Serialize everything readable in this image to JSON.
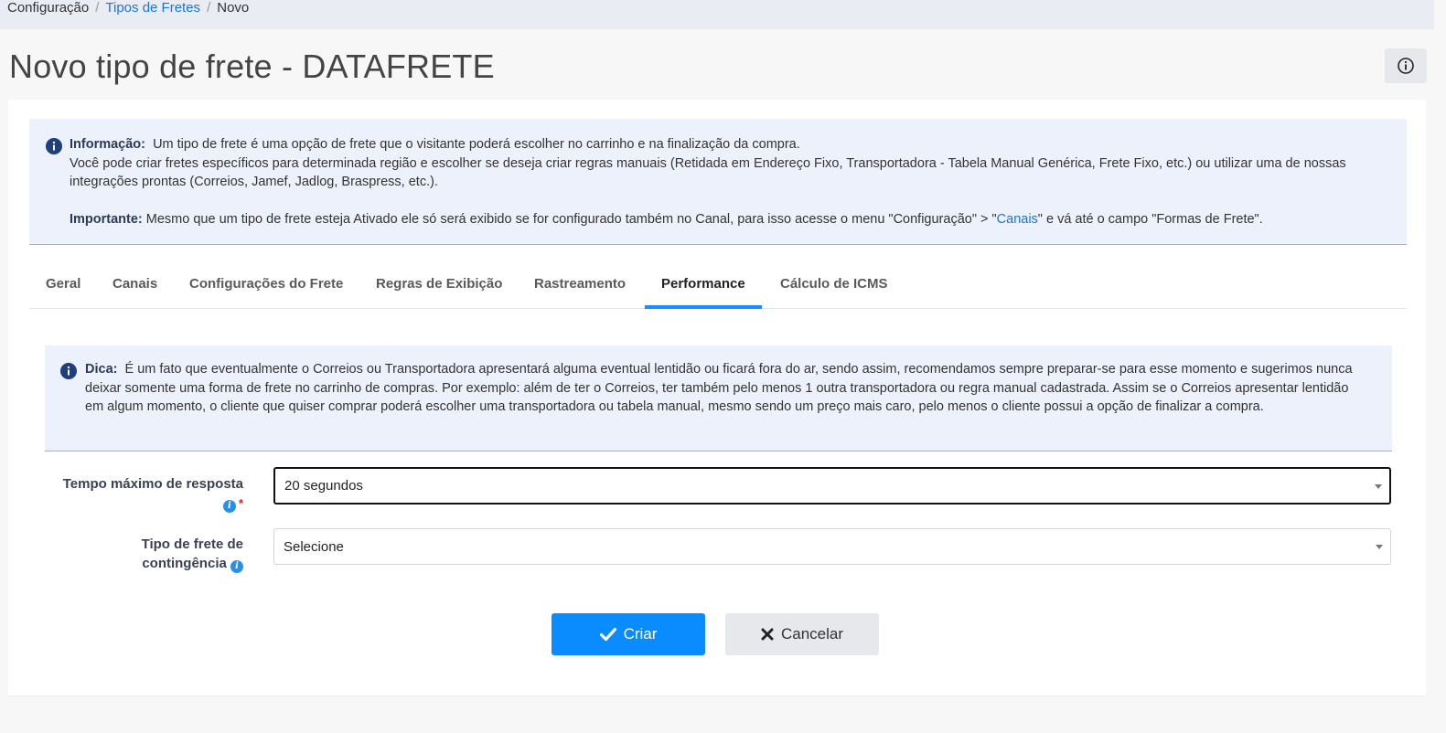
{
  "breadcrumb": {
    "items": [
      "Configuração",
      "Tipos de Fretes",
      "Novo"
    ],
    "separator": "/"
  },
  "page_title": "Novo tipo de frete - DATAFRETE",
  "info_alert": {
    "label": "Informação:",
    "line1": "Um tipo de frete é uma opção de frete que o visitante poderá escolher no carrinho e na finalização da compra.",
    "line2": "Você pode criar fretes específicos para determinada região e escolher se deseja criar regras manuais (Retidada em Endereço Fixo, Transportadora - Tabela Manual Genérica, Frete Fixo, etc.) ou utilizar uma de nossas integrações prontas (Correios, Jamef, Jadlog, Braspress, etc.).",
    "important_label": "Importante:",
    "important_text_before": "Mesmo que um tipo de frete esteja Ativado ele só será exibido se for configurado também no Canal, para isso acesse o menu \"Configuração\" > \"",
    "important_link": "Canais",
    "important_text_after": "\" e vá até o campo \"Formas de Frete\"."
  },
  "tabs": [
    {
      "label": "Geral",
      "active": false
    },
    {
      "label": "Canais",
      "active": false
    },
    {
      "label": "Configurações do Frete",
      "active": false
    },
    {
      "label": "Regras de Exibição",
      "active": false
    },
    {
      "label": "Rastreamento",
      "active": false
    },
    {
      "label": "Performance",
      "active": true
    },
    {
      "label": "Cálculo de ICMS",
      "active": false
    }
  ],
  "tip_alert": {
    "label": "Dica:",
    "text": "É um fato que eventualmente o Correios ou Transportadora apresentará alguma eventual lentidão ou ficará fora do ar, sendo assim, recomendamos sempre preparar-se para esse momento e sugerimos nunca deixar somente uma forma de frete no carrinho de compras. Por exemplo: além de ter o Correios, ter também pelo menos 1 outra transportadora ou regra manual cadastrada. Assim se o Correios apresentar lentidão em algum momento, o cliente que quiser comprar poderá escolher uma transportadora ou tabela manual, mesmo sendo um preço mais caro, pelo menos o cliente possui a opção de finalizar a compra."
  },
  "form": {
    "max_time": {
      "label": "Tempo máximo de resposta",
      "required_mark": "*",
      "value": "20 segundos"
    },
    "contingency": {
      "label_line1": "Tipo de frete de",
      "label_line2": "contingência",
      "value": "Selecione"
    }
  },
  "buttons": {
    "create": "Criar",
    "cancel": "Cancelar"
  },
  "colors": {
    "primary": "#0a8cff",
    "link": "#1a73e8",
    "alert_bg": "#ecf1fb",
    "info_icon": "#1f3f7a"
  },
  "icons": {
    "info": "info-circle-icon",
    "check": "check-icon",
    "close": "times-icon"
  }
}
